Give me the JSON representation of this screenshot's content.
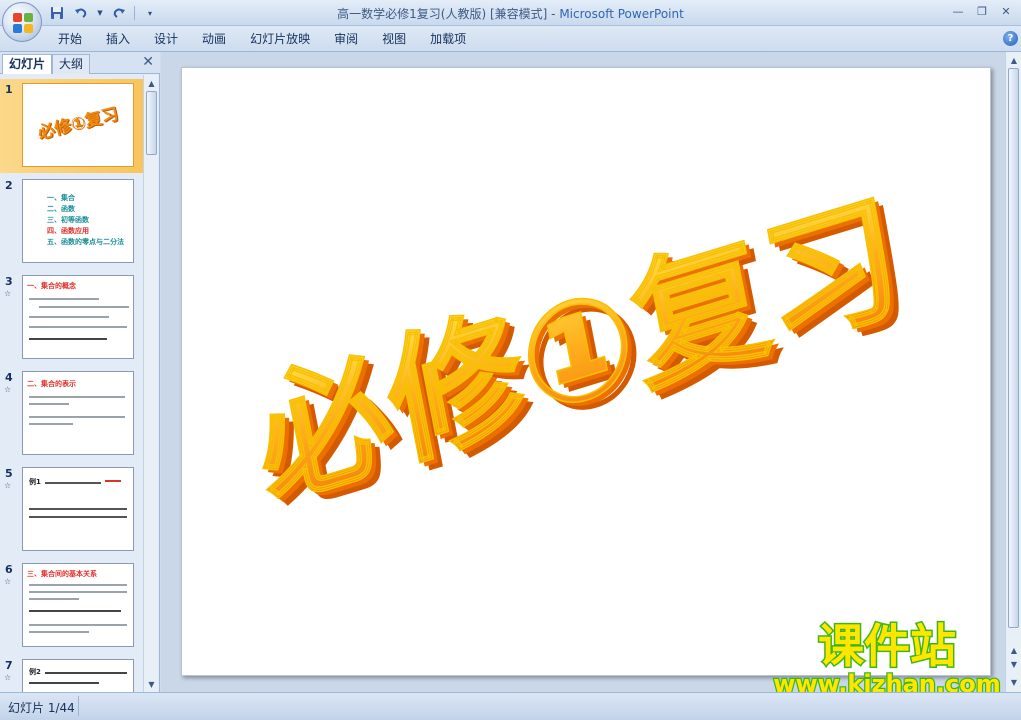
{
  "window": {
    "title": "高一数学必修1复习(人教版) [兼容模式]",
    "title_sep": " - ",
    "app_name": "Microsoft PowerPoint",
    "minimize": "—",
    "restore": "❐",
    "close": "✕"
  },
  "quick_access": {
    "save_icon": "save-icon",
    "undo_icon": "undo-icon",
    "redo_icon": "redo-icon",
    "customize_icon": "customize-icon"
  },
  "ribbon": {
    "tabs": [
      "开始",
      "插入",
      "设计",
      "动画",
      "幻灯片放映",
      "审阅",
      "视图",
      "加载项"
    ],
    "help": "?"
  },
  "left_pane": {
    "tab_slides": "幻灯片",
    "tab_outline": "大纲",
    "close": "✕",
    "thumbnails": [
      {
        "num": "1",
        "anim": "",
        "title": "必修①复习"
      },
      {
        "num": "2",
        "anim": "",
        "items": [
          "一、集合",
          "二、函数",
          "三、初等函数",
          "四、函数应用",
          "五、函数的零点与二分法"
        ]
      },
      {
        "num": "3",
        "anim": "☆",
        "heading": "一、集合的概念"
      },
      {
        "num": "4",
        "anim": "☆",
        "heading": "二、集合的表示"
      },
      {
        "num": "5",
        "anim": "☆",
        "heading": "例1"
      },
      {
        "num": "6",
        "anim": "☆",
        "heading": "三、集合间的基本关系"
      },
      {
        "num": "7",
        "anim": "☆",
        "heading": "例2"
      }
    ]
  },
  "slide": {
    "art_text": "必修①复习"
  },
  "watermark": {
    "name": "课件站",
    "url": "www.kjzhan.com"
  },
  "status": {
    "slide_info": "幻灯片 1/44"
  },
  "colors": {
    "accent": "#f08a12",
    "art_top": "#ffd000",
    "art_side": "#e66a00",
    "watermark_green": "#3cb815"
  }
}
